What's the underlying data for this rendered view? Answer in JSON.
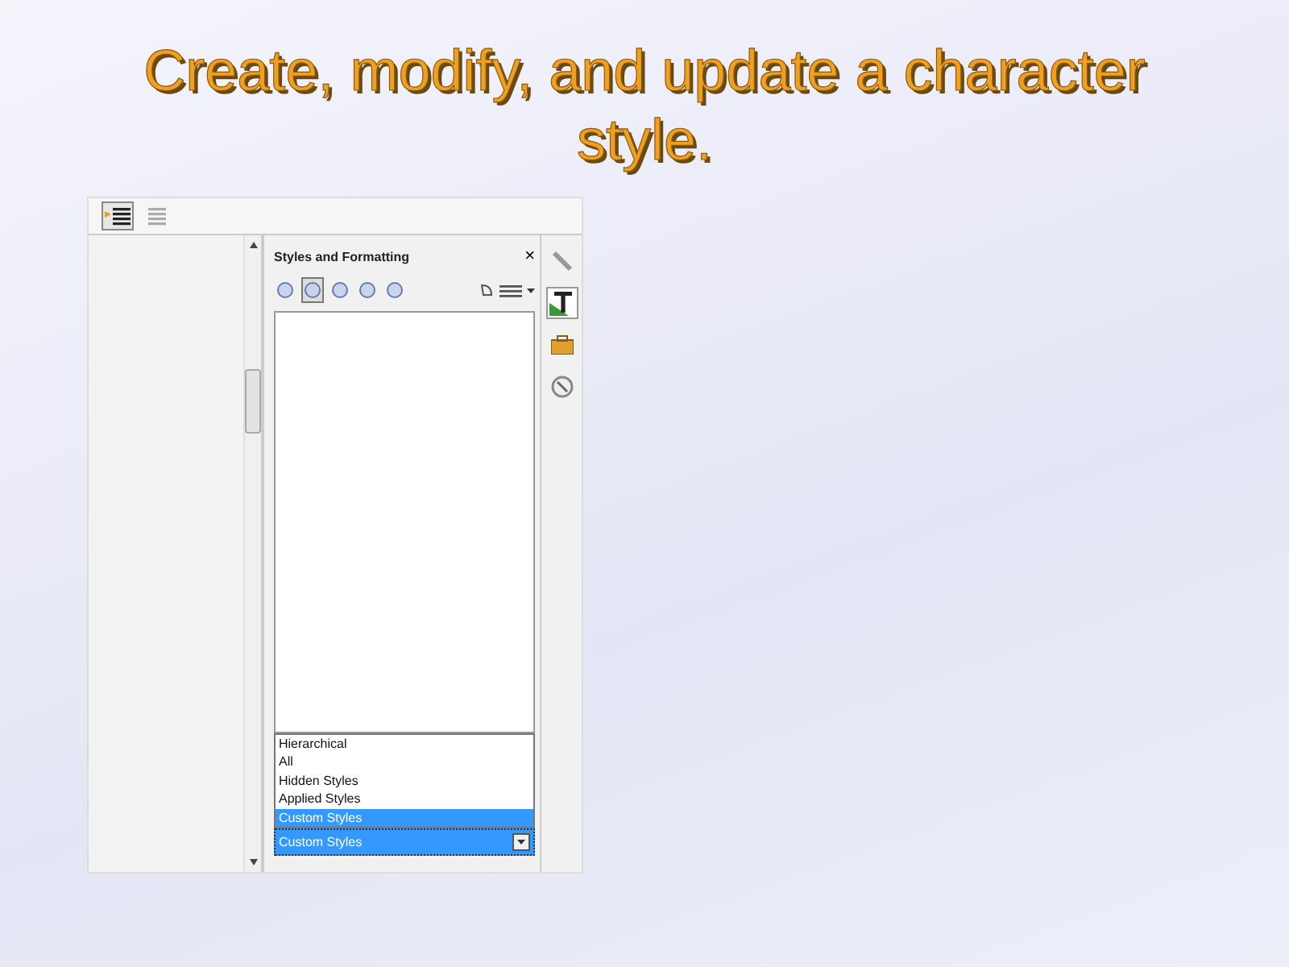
{
  "slide": {
    "title": "Create, modify, and update a character style."
  },
  "toolbar": {
    "buttons": [
      {
        "kind": "list",
        "selected": true
      },
      {
        "kind": "outline",
        "selected": false
      }
    ]
  },
  "panel": {
    "title": "Styles and Formatting",
    "close": "×",
    "families": [
      {
        "selected": false
      },
      {
        "selected": true
      },
      {
        "selected": false
      },
      {
        "selected": false
      },
      {
        "selected": false
      }
    ],
    "filter_options": [
      {
        "label": "Hierarchical",
        "selected": false
      },
      {
        "label": "All",
        "selected": false
      },
      {
        "label": "Hidden Styles",
        "selected": false
      },
      {
        "label": "Applied Styles",
        "selected": false
      },
      {
        "label": "Custom Styles",
        "selected": true
      }
    ],
    "filter_value": "Custom Styles"
  },
  "sidebar_tabs": [
    {
      "kind": "properties",
      "selected": false
    },
    {
      "kind": "styles",
      "selected": true
    },
    {
      "kind": "gallery",
      "selected": false
    },
    {
      "kind": "navigator",
      "selected": false
    }
  ]
}
